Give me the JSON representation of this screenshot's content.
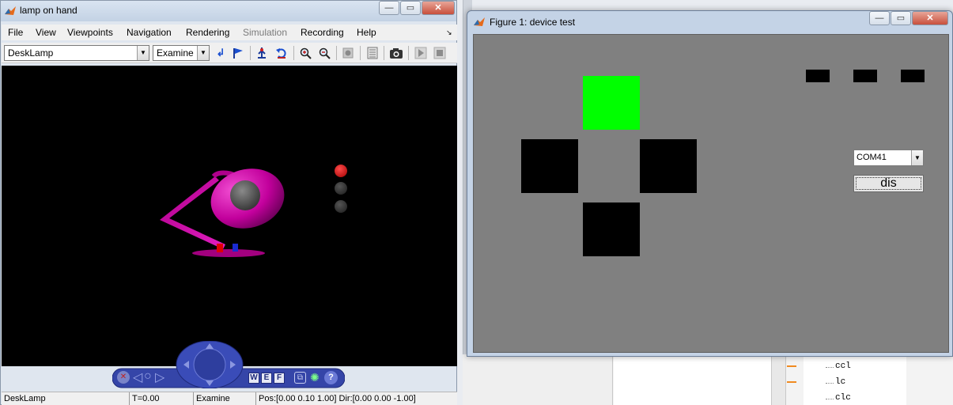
{
  "left_window": {
    "title": "lamp on hand",
    "buttons": {
      "minimize": "—",
      "maximize": "▭",
      "close": "✕"
    },
    "menu": [
      "File",
      "View",
      "Viewpoints",
      "Navigation",
      "Rendering",
      "Simulation",
      "Recording",
      "Help"
    ],
    "menu_disabled": [
      "Simulation"
    ],
    "toolbar": {
      "viewpoint_select": "DeskLamp",
      "mode_select": "Examine",
      "icons": [
        "return-icon",
        "flag-icon",
        "straighten-icon",
        "undo-move-icon",
        "zoom-in-icon",
        "zoom-out-icon",
        "record-icon",
        "scene-tree-icon",
        "camera-icon",
        "play-icon",
        "stop-icon"
      ]
    },
    "navpanel": {
      "letters": {
        "w": "W",
        "e": "E",
        "f": "F"
      },
      "help": "?"
    },
    "status": {
      "viewpoint": "DeskLamp",
      "time": "T=0.00",
      "mode": "Examine",
      "position": "Pos:[0.00 0.10 1.00] Dir:[0.00 0.00 -1.00]"
    }
  },
  "figure_window": {
    "title": "Figure 1: device test",
    "buttons": {
      "minimize": "—",
      "maximize": "▭",
      "close": "✕"
    },
    "com_port": "COM41",
    "dis_button": "dis",
    "pad_colors": {
      "top": "#00ff00",
      "left": "#000000",
      "right": "#000000",
      "bottom": "#000000"
    }
  },
  "background_app": {
    "tree_items": [
      "ccl",
      "lc",
      "clc"
    ]
  }
}
